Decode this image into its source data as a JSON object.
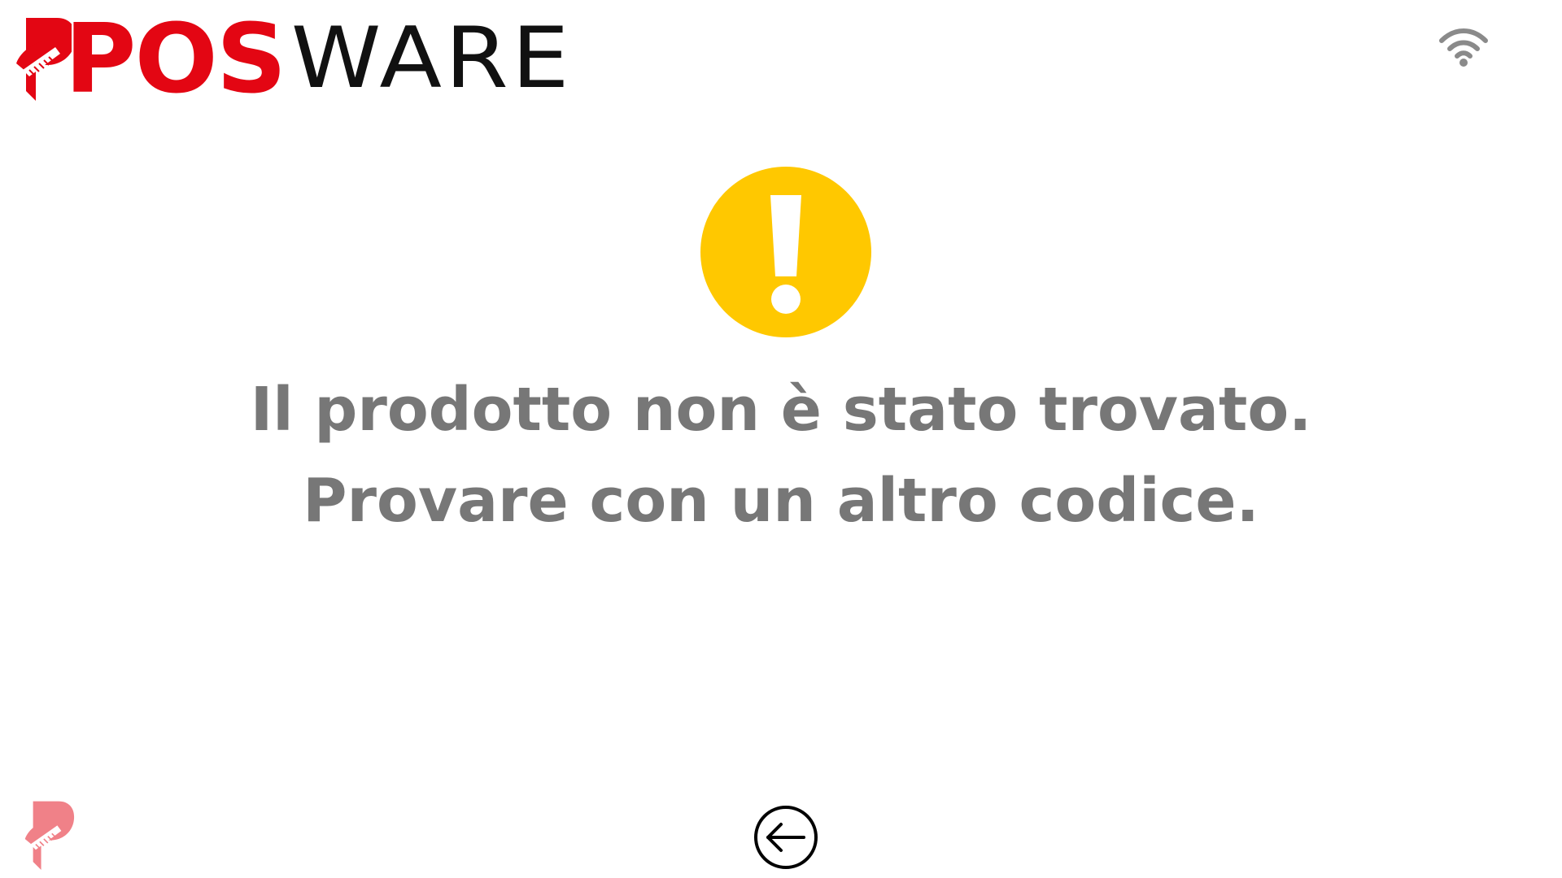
{
  "brand": {
    "pos_text": "POS",
    "ware_text": "WARE",
    "pos_color": "#e30613",
    "ware_color": "#111111",
    "footer_mark_color": "#e30613"
  },
  "status": {
    "icon": "wifi-icon",
    "color": "#8a8a8a"
  },
  "alert": {
    "icon": "warning-icon",
    "icon_color": "#ffc800",
    "line1": "Il prodotto non è stato trovato.",
    "line2": "Provare con un altro codice.",
    "text_color": "#777777"
  },
  "navigation": {
    "back_icon": "arrow-left-icon",
    "back_icon_color": "#000000"
  }
}
